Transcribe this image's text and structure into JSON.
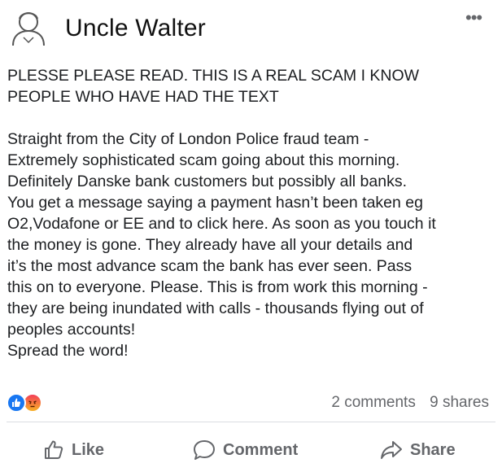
{
  "post": {
    "author": "Uncle Walter",
    "more_label": "•••",
    "headline_lines": [
      "PLESSE PLEASE READ. THIS IS A REAL SCAM I KNOW",
      "PEOPLE WHO HAVE HAD THE TEXT"
    ],
    "body_lines": [
      "Straight from the City of London Police fraud team -",
      "Extremely sophisticated scam going about this morning.",
      "Definitely Danske bank customers but possibly all banks.",
      "You get a message saying a payment hasn’t been taken eg",
      "O2,Vodafone or EE and to click here. As soon as you touch it",
      "the money is gone. They already have all your details and",
      "it’s the most advance scam the bank has ever seen. Pass",
      "this on to everyone. Please. This is from work this morning -",
      "they are being inundated with calls - thousands flying out of",
      "peoples accounts!",
      "Spread the word!"
    ]
  },
  "stats": {
    "reactions": [
      "like-icon",
      "angry-icon"
    ],
    "comments": "2 comments",
    "shares": "9 shares"
  },
  "actions": {
    "like": "Like",
    "comment": "Comment",
    "share": "Share"
  },
  "colors": {
    "accent": "#1877f2",
    "secondary_text": "#65676b",
    "angry_top": "#f33e58",
    "angry_bottom": "#f7b125"
  }
}
